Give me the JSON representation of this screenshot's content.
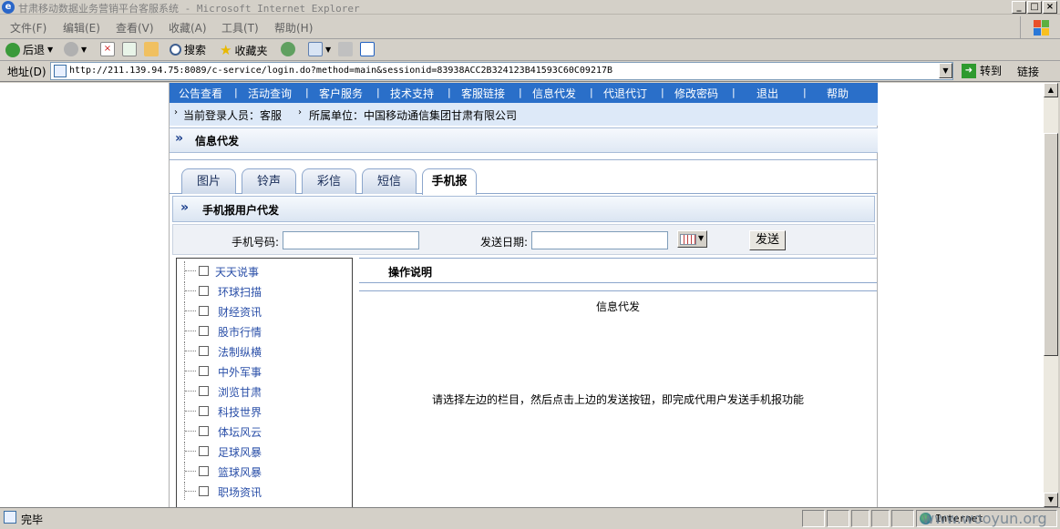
{
  "window": {
    "title": "甘肃移动数据业务营销平台客服系统 - Microsoft Internet Explorer",
    "buttons": [
      "_",
      "□",
      "×"
    ]
  },
  "menubar": {
    "items": [
      "文件(F)",
      "编辑(E)",
      "查看(V)",
      "收藏(A)",
      "工具(T)",
      "帮助(H)"
    ]
  },
  "toolbar": {
    "back": "后退",
    "search": "搜索",
    "favorites": "收藏夹"
  },
  "address": {
    "label": "地址(D)",
    "url": "http://211.139.94.75:8089/c-service/login.do?method=main&sessionid=83938ACC2B324123B41593C60C09217B",
    "go": "转到",
    "links": "链接"
  },
  "nav": {
    "items": [
      "公告查看",
      "活动查询",
      "客户服务",
      "技术支持",
      "客服链接",
      "信息代发",
      "代退代订",
      "修改密码",
      "退出",
      "帮助"
    ]
  },
  "info": {
    "login_user": "当前登录人员：客服",
    "org": "所属单位：中国移动通信集团甘肃有限公司"
  },
  "section": {
    "title": "信息代发"
  },
  "tabs": [
    "图片",
    "铃声",
    "彩信",
    "短信",
    "手机报"
  ],
  "active_tab": "手机报",
  "subsection": {
    "title": "手机报用户代发"
  },
  "form": {
    "phone_label": "手机号码:",
    "phone_value": "",
    "date_label": "发送日期:",
    "date_value": "",
    "send_button": "发送"
  },
  "tree": {
    "items": [
      "天天说事",
      "环球扫描",
      "财经资讯",
      "股市行情",
      "法制纵横",
      "中外军事",
      "浏览甘肃",
      "科技世界",
      "体坛风云",
      "足球风暴",
      "篮球风暴",
      "职场资讯"
    ]
  },
  "panel": {
    "header": "操作说明",
    "title": "信息代发",
    "message": "请选择左边的栏目，然后点击上边的发送按钮，即完成代用户发送手机报功能"
  },
  "status": {
    "text": "完毕",
    "zone": "Internet"
  },
  "watermark": "www.wooyun.org"
}
